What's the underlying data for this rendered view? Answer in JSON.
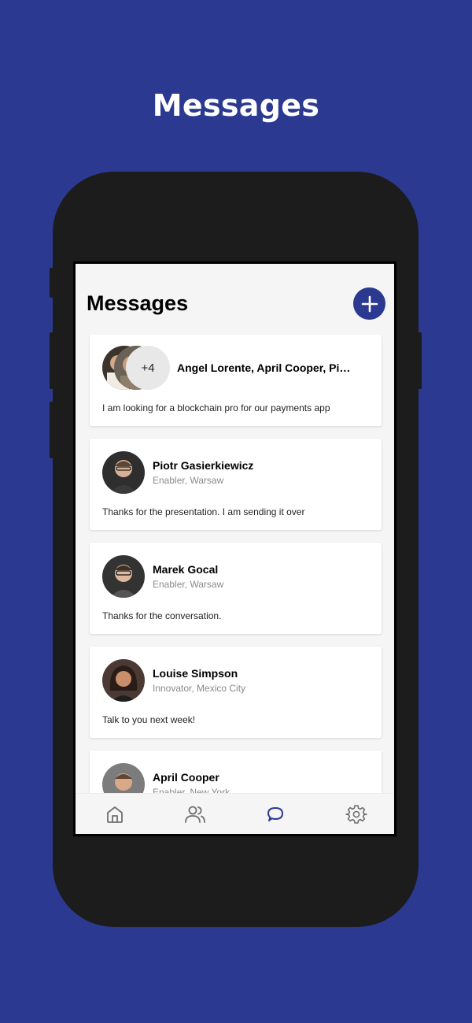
{
  "promo": {
    "title": "Messages"
  },
  "app": {
    "title": "Messages"
  },
  "icons": {
    "add": "plus-icon",
    "home": "home-icon",
    "people": "people-icon",
    "messages": "chat-bubble-icon",
    "settings": "gear-icon"
  },
  "colors": {
    "brand": "#2b3990",
    "active_tab": "#2b3990",
    "inactive_tab": "#6f6f6f"
  },
  "group": {
    "more_count": "+4",
    "names": "Angel Lorente, April Cooper, Piotr Gasierkiewicz, Marek Gocal, Louise Simpson",
    "preview": "I am looking for a blockchain pro for our payments app"
  },
  "conversations": [
    {
      "name": "Piotr Gasierkiewicz",
      "role": "Enabler, Warsaw",
      "preview": "Thanks for the presentation. I am sending it over"
    },
    {
      "name": "Marek Gocal",
      "role": "Enabler, Warsaw",
      "preview": "Thanks for the conversation."
    },
    {
      "name": "Louise Simpson",
      "role": "Innovator, Mexico City",
      "preview": "Talk to you next week!"
    },
    {
      "name": "April Cooper",
      "role": "Enabler, New York",
      "preview": ""
    }
  ],
  "tabs": {
    "active": "messages"
  }
}
